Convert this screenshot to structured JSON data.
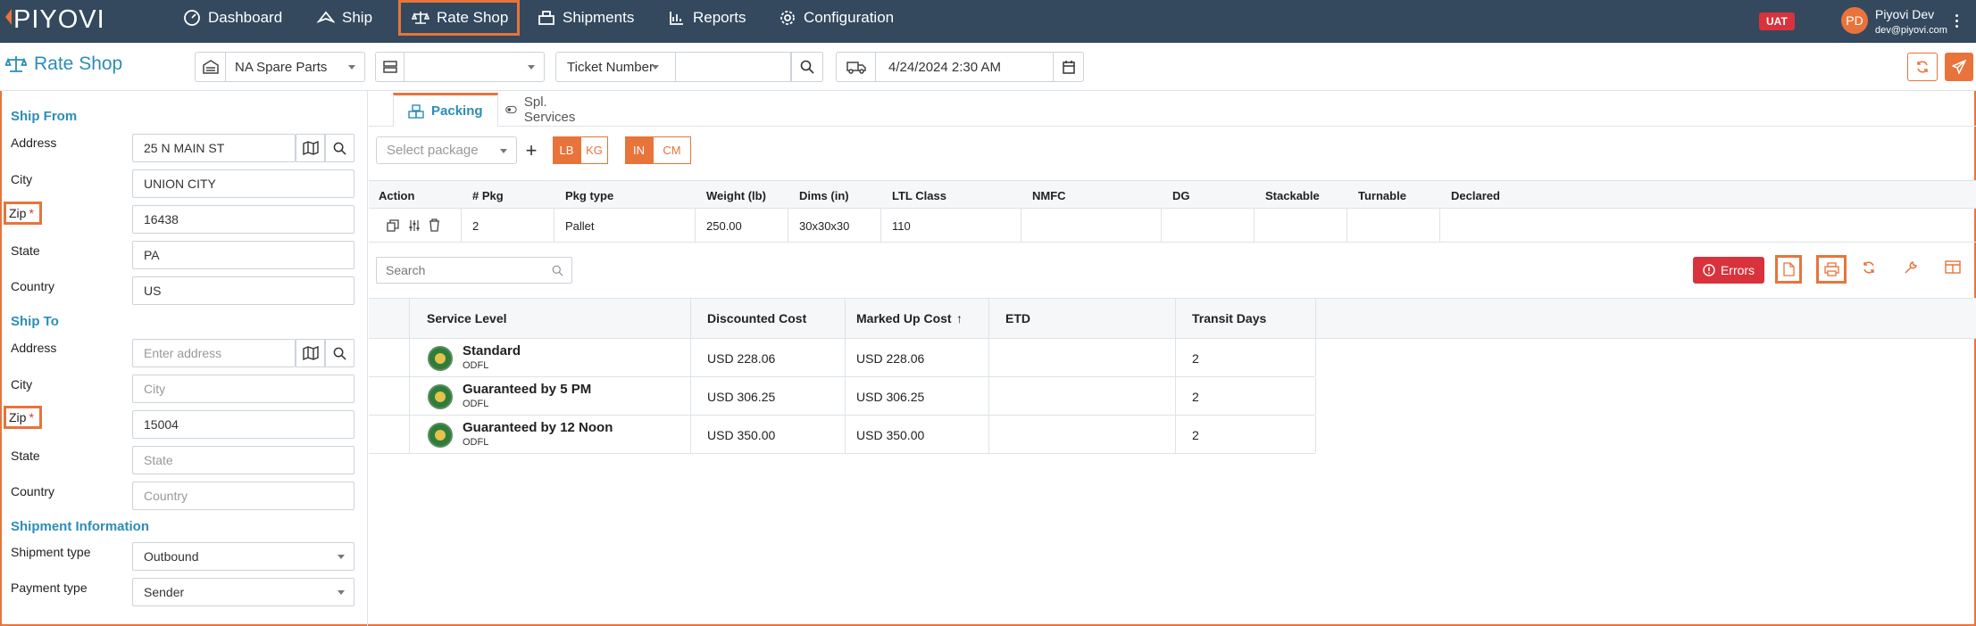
{
  "app": {
    "logo": "PIYOVI"
  },
  "nav": {
    "items": [
      {
        "label": "Dashboard",
        "icon": "dashboard-icon"
      },
      {
        "label": "Ship",
        "icon": "ship-icon"
      },
      {
        "label": "Rate Shop",
        "icon": "scale-icon"
      },
      {
        "label": "Shipments",
        "icon": "shipments-icon"
      },
      {
        "label": "Reports",
        "icon": "reports-icon"
      },
      {
        "label": "Configuration",
        "icon": "gear-icon"
      }
    ],
    "active": "Rate Shop"
  },
  "env_badge": "UAT",
  "user": {
    "initials": "PD",
    "name": "Piyovi Dev",
    "email": "dev@piyovi.com"
  },
  "toolbar": {
    "title": "Rate Shop",
    "location": "NA Spare Parts",
    "second_select": "",
    "reference_type": "Ticket Number",
    "reference_value": "",
    "ship_date": "4/24/2024 2:30 AM"
  },
  "ship_from": {
    "title": "Ship From",
    "address_label": "Address",
    "address": "25 N MAIN ST",
    "city_label": "City",
    "city": "UNION CITY",
    "zip_label": "Zip",
    "zip": "16438",
    "state_label": "State",
    "state": "PA",
    "country_label": "Country",
    "country": "US"
  },
  "ship_to": {
    "title": "Ship To",
    "address_label": "Address",
    "address_placeholder": "Enter address",
    "city_label": "City",
    "city_placeholder": "City",
    "zip_label": "Zip",
    "zip": "15004",
    "state_label": "State",
    "state_placeholder": "State",
    "country_label": "Country",
    "country_placeholder": "Country"
  },
  "shipment_info": {
    "title": "Shipment Information",
    "type_label": "Shipment type",
    "type": "Outbound",
    "payment_label": "Payment type",
    "payment": "Sender"
  },
  "tabs": [
    {
      "label": "Packing"
    },
    {
      "label": "Spl. Services"
    }
  ],
  "packing": {
    "select_placeholder": "Select package",
    "weight_units": [
      "LB",
      "KG"
    ],
    "dim_units": [
      "IN",
      "CM"
    ],
    "columns": [
      "Action",
      "# Pkg",
      "Pkg type",
      "Weight (lb)",
      "Dims (in)",
      "LTL Class",
      "NMFC",
      "DG",
      "Stackable",
      "Turnable",
      "Declared"
    ],
    "rows": [
      {
        "pkg": "2",
        "pkg_type": "Pallet",
        "weight": "250.00",
        "dims": "30x30x30",
        "ltl_class": "110",
        "nmfc": "",
        "dg": "",
        "stackable": "",
        "turnable": "",
        "declared": ""
      }
    ]
  },
  "results": {
    "search_placeholder": "Search",
    "errors_label": "Errors",
    "columns": [
      "Service Level",
      "Discounted Cost",
      "Marked Up Cost",
      "ETD",
      "Transit Days"
    ],
    "sort_arrow": "↑",
    "rows": [
      {
        "service": "Standard",
        "carrier": "ODFL",
        "discounted": "USD 228.06",
        "marked_up": "USD 228.06",
        "etd": "",
        "transit": "2"
      },
      {
        "service": "Guaranteed by 5 PM",
        "carrier": "ODFL",
        "discounted": "USD 306.25",
        "marked_up": "USD 306.25",
        "etd": "",
        "transit": "2"
      },
      {
        "service": "Guaranteed by 12 Noon",
        "carrier": "ODFL",
        "discounted": "USD 350.00",
        "marked_up": "USD 350.00",
        "etd": "",
        "transit": "2"
      }
    ]
  },
  "colors": {
    "nav_bg": "#34495e",
    "accent": "#e8743b",
    "title_blue": "#2c8db7",
    "danger": "#d9323c"
  }
}
